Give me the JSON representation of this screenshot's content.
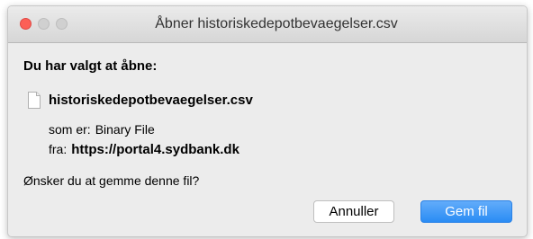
{
  "window": {
    "title": "Åbner historiskedepotbevaegelser.csv"
  },
  "dialog": {
    "heading": "Du har valgt at åbne:",
    "filename": "historiskedepotbevaegelser.csv",
    "kind_label": "som er:",
    "kind_value": "Binary File",
    "from_label": "fra:",
    "from_value": "https://portal4.sydbank.dk",
    "question": "Ønsker du at gemme denne fil?"
  },
  "buttons": {
    "cancel_label": "Annuller",
    "save_label": "Gem fil"
  },
  "icons": {
    "file": "document-icon",
    "close": "close-window-icon",
    "minimize": "minimize-window-icon",
    "zoom": "zoom-window-icon"
  },
  "colors": {
    "close_button": "#fc5f57",
    "primary_button": "#2a8cf4"
  }
}
